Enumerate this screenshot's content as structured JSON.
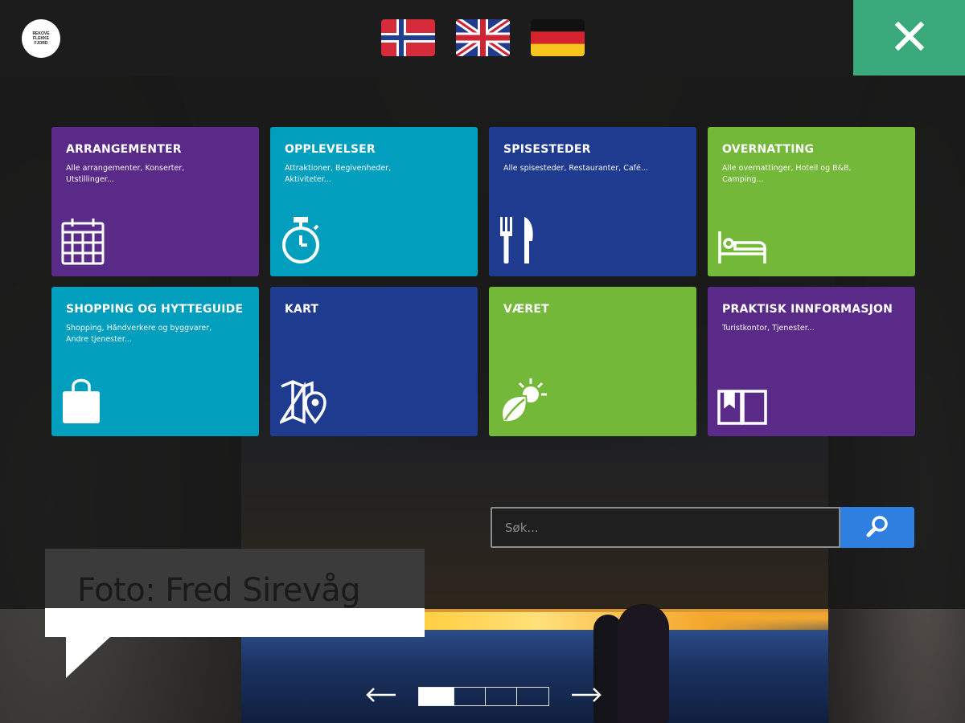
{
  "logo": {
    "text": "REKOVE\nFLEKKE\nFJORD"
  },
  "languages": [
    {
      "name": "norwegian-flag-icon"
    },
    {
      "name": "uk-flag-icon"
    },
    {
      "name": "german-flag-icon"
    }
  ],
  "close": {
    "icon": "close-icon"
  },
  "tiles": [
    {
      "title": "ARRANGEMENTER",
      "subtitle": "Alle arrangementer, Konserter, Utstillinger...",
      "icon": "calendar-icon",
      "color": "#5a2a88"
    },
    {
      "title": "OPPLEVELSER",
      "subtitle": "Attraktioner, Begivenheder, Aktiviteter...",
      "icon": "stopwatch-icon",
      "color": "#019ebd"
    },
    {
      "title": "SPISESTEDER",
      "subtitle": "Alle spisesteder, Restauranter, Café...",
      "icon": "cutlery-icon",
      "color": "#1f3b8f"
    },
    {
      "title": "OVERNATTING",
      "subtitle": "Alle overnattinger, Hotell og B&B, Camping...",
      "icon": "bed-icon",
      "color": "#74b839"
    },
    {
      "title": "SHOPPING OG HYTTEGUIDE",
      "subtitle": "Shopping, Håndverkere og byggvarer, Andre tjenester...",
      "icon": "shopping-bag-icon",
      "color": "#019ebd"
    },
    {
      "title": "KART",
      "subtitle": "",
      "icon": "map-icon",
      "color": "#1f3b8f"
    },
    {
      "title": "VÆRET",
      "subtitle": "",
      "icon": "weather-icon",
      "color": "#74b839"
    },
    {
      "title": "PRAKTISK INNFORMASJON",
      "subtitle": "Turistkontor, Tjenester...",
      "icon": "book-icon",
      "color": "#5a2a88"
    }
  ],
  "search": {
    "placeholder": "Søk...",
    "value": "",
    "icon": "search-icon",
    "button_color": "#2f7fe0"
  },
  "photo_credit": {
    "text": "Foto: Fred Sirevåg"
  },
  "slider": {
    "prev_icon": "arrow-left-icon",
    "next_icon": "arrow-right-icon",
    "pages": 4,
    "current": 1
  },
  "accent_color": "#3aaa7d"
}
